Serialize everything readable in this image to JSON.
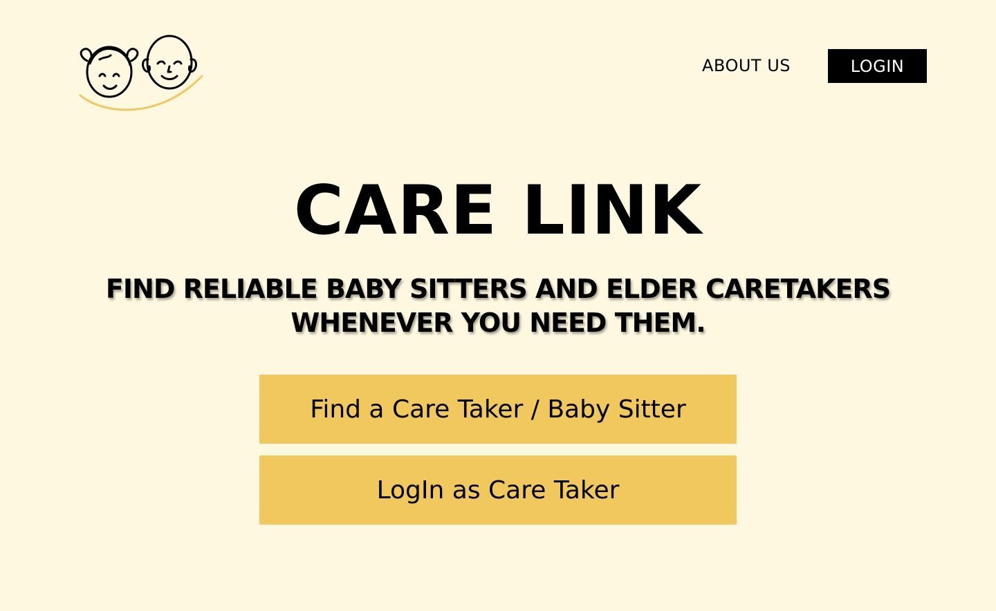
{
  "header": {
    "logo_icon": "child-and-elder-faces-logo",
    "about_label": "ABOUT US",
    "login_label": "LOGIN"
  },
  "hero": {
    "title": "CARE LINK",
    "subtitle_line1": "FIND RELIABLE BABY SITTERS AND ELDER CARETAKERS",
    "subtitle_line2": "WHENEVER YOU NEED THEM."
  },
  "actions": {
    "find_label": "Find a Care Taker / Baby Sitter",
    "caretaker_login_label": "LogIn as Care Taker"
  },
  "colors": {
    "background": "#FEF8E1",
    "button_fill": "#F0C85E",
    "login_fill": "#000000",
    "logo_arc": "#F0C85E"
  }
}
